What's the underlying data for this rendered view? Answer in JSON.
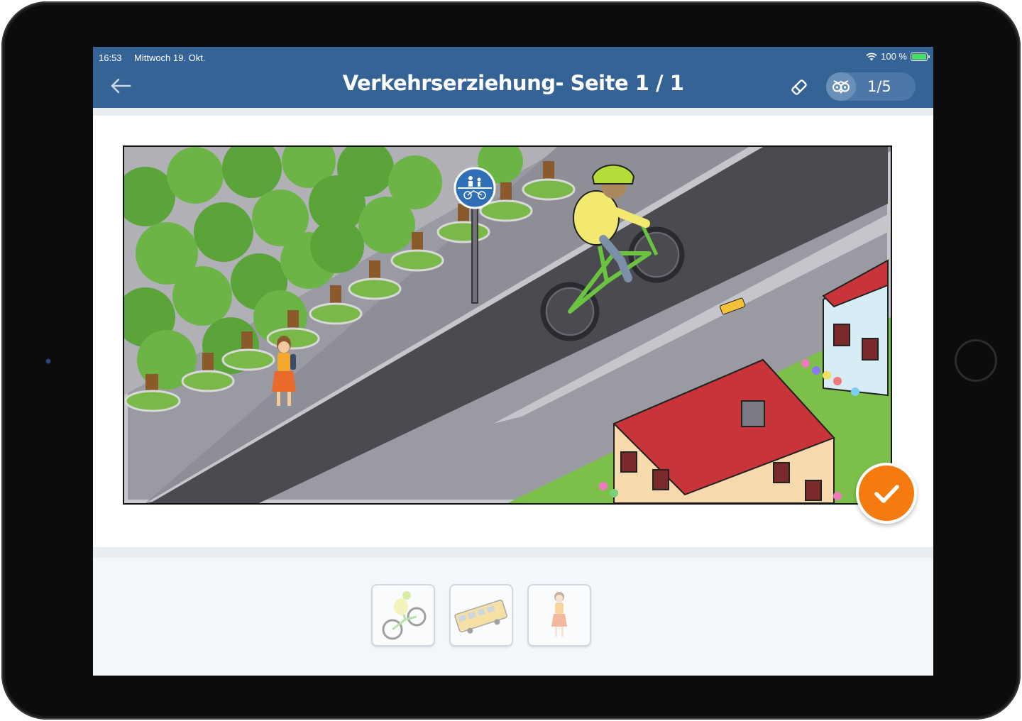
{
  "status_bar": {
    "time": "16:53",
    "date": "Mittwoch 19. Okt.",
    "battery": "100 %"
  },
  "header": {
    "title": "Verkehrserziehung- Seite 1 / 1",
    "progress_counter": "1/5"
  },
  "colors": {
    "header": "#366396",
    "accent": "#f57a0f",
    "tray": "#f3f6fa"
  },
  "answer_tray": {
    "items": [
      "cyclist-image",
      "bus-image",
      "girl-image"
    ]
  }
}
